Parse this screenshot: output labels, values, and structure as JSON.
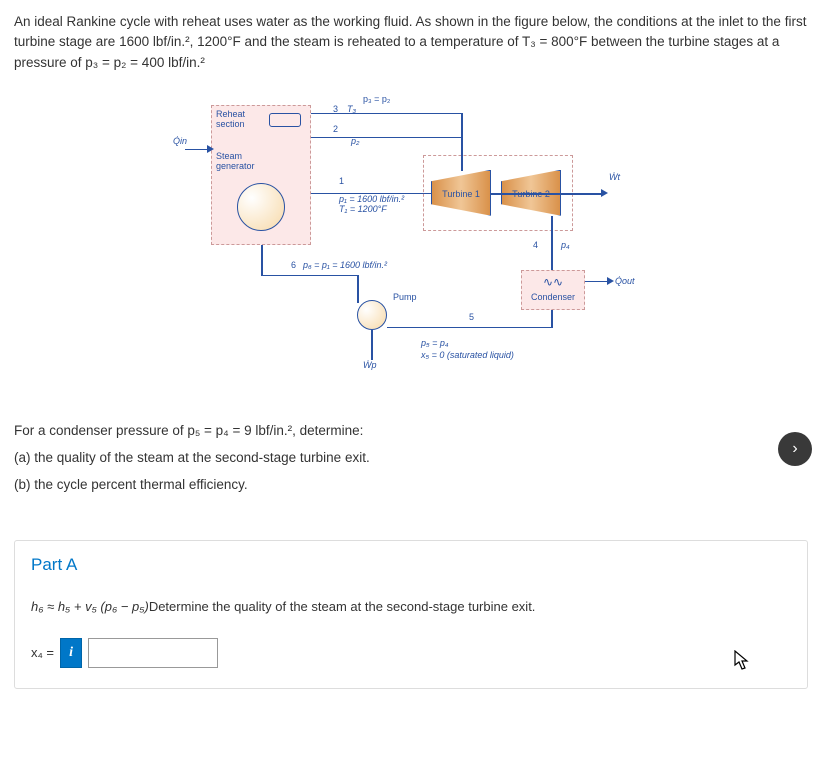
{
  "problem": {
    "text": "An ideal Rankine cycle with reheat uses water as the working fluid. As shown in the figure below, the conditions at the inlet to the first turbine stage are 1600 lbf/in.², 1200°F and the steam is reheated to a temperature of T₃ = 800°F between the turbine stages at a pressure of p₃ = p₂ = 400 lbf/in.²"
  },
  "diagram": {
    "reheat_label": "Reheat\nsection",
    "steam_label": "Steam\ngenerator",
    "qin": "Q̇in",
    "p3p2": "p₃ = p₂",
    "state3": "3",
    "T3": "T₃",
    "state2": "2",
    "p2": "p₂",
    "state1": "1",
    "p1T1": "p₁ = 1600 lbf/in.²\nT₁ = 1200°F",
    "turbine1": "Turbine 1",
    "turbine2": "Turbine 2",
    "Wt": "Ẇt",
    "state4": "4",
    "p4": "p₄",
    "condenser": "Condenser",
    "qout": "Q̇out",
    "state5": "5",
    "p5p4": "p₅ = p₄",
    "x5": "x₅ = 0 (saturated liquid)",
    "state6": "6",
    "p6p1": "p₆ = p₁ = 1600 lbf/in.²",
    "pump": "Pump",
    "Wp": "Ẇp"
  },
  "questions": {
    "intro": "For a condenser pressure of p₅ = p₄ = 9 lbf/in.², determine:",
    "a": "(a) the quality of the steam at the second-stage turbine exit.",
    "b": "(b) the cycle percent thermal efficiency."
  },
  "partA": {
    "title": "Part A",
    "hint_formula": "h₆ ≈ h₅ + v₅ (p₆ − p₅)",
    "hint_text": "Determine the quality of the steam at the second-stage turbine exit.",
    "answer_label": "x₄ =",
    "answer_value": ""
  },
  "next_arrow": "›"
}
